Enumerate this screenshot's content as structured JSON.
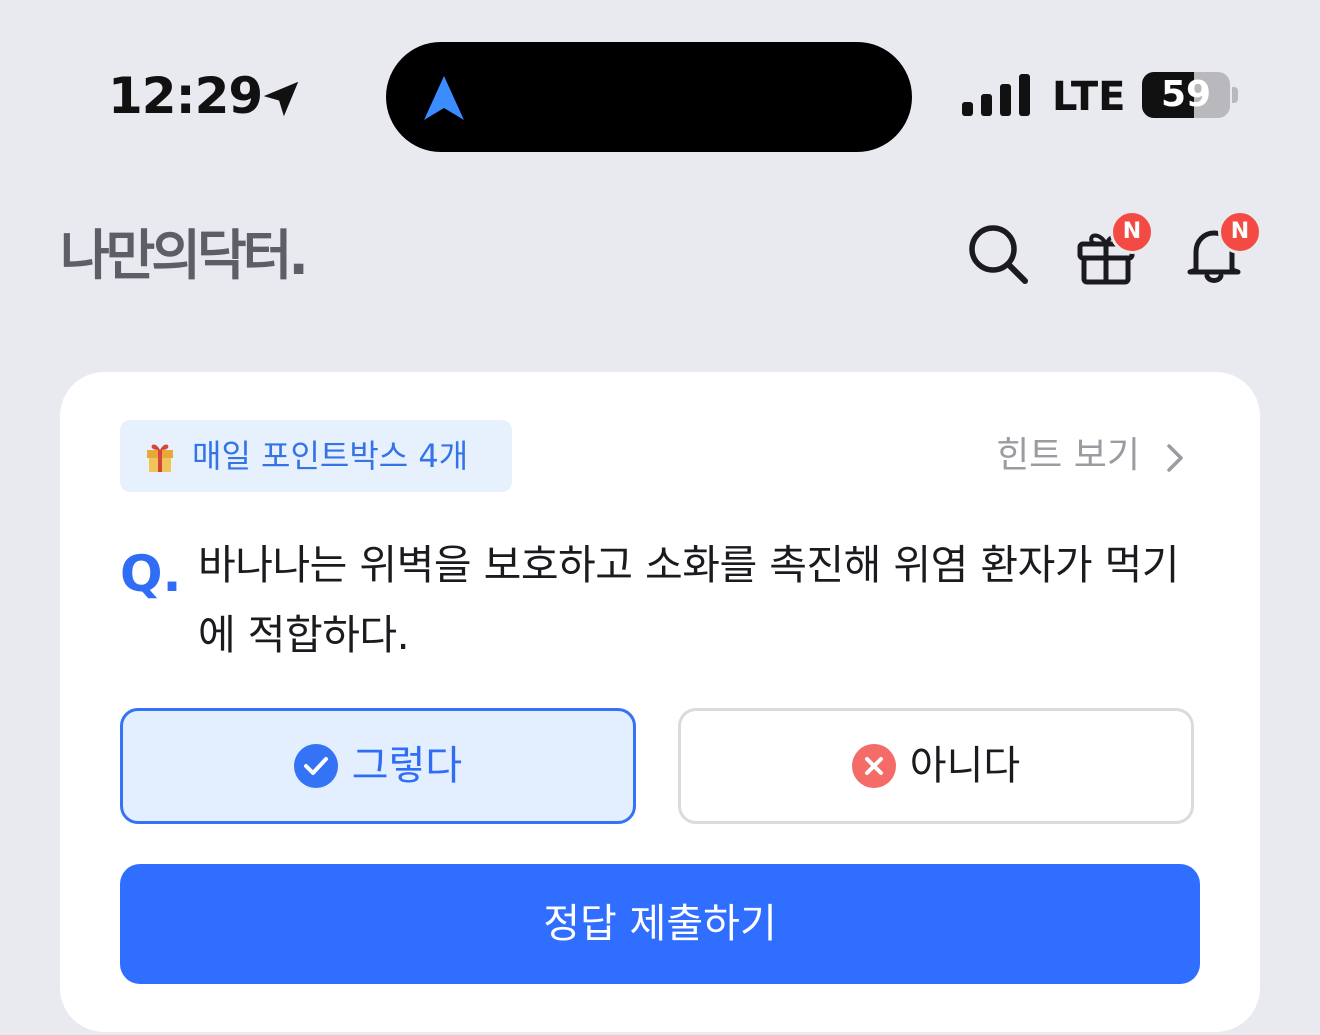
{
  "status_bar": {
    "time": "12:29",
    "network": "LTE",
    "battery_percent": "59",
    "battery_level": 0.59,
    "location_icon": "location-arrow-icon",
    "nav_icon": "navigation-arrow-icon",
    "signal_icon": "signal-bars-icon"
  },
  "header": {
    "logo": "나만의닥터.",
    "search_icon": "search-icon",
    "gift_icon": "gift-icon",
    "bell_icon": "bell-icon",
    "gift_badge": "N",
    "bell_badge": "N"
  },
  "quiz": {
    "pill_label": "매일 포인트박스 4개",
    "hint_label": "힌트 보기",
    "q_mark": "Q.",
    "question": "바나나는 위벽을 보호하고 소화를 촉진해 위염 환자가 먹기에 적합하다.",
    "options": [
      {
        "label": "그렇다",
        "icon": "check-circle-icon",
        "selected": true
      },
      {
        "label": "아니다",
        "icon": "x-circle-icon",
        "selected": false
      }
    ],
    "submit_label": "정답 제출하기"
  },
  "colors": {
    "background": "#E9EAEF",
    "accent": "#306EFF",
    "badge": "#F44A44",
    "selected_bg": "#E3EEFE",
    "no_icon": "#F46B67"
  }
}
